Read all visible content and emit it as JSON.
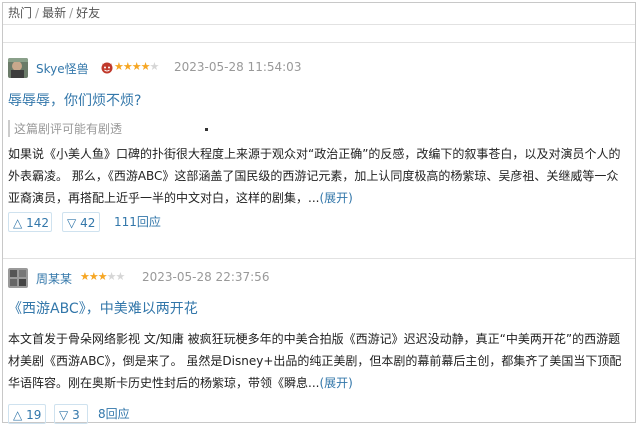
{
  "tabs": {
    "hot": "热门",
    "latest": "最新",
    "friends": "好友",
    "sep": "/"
  },
  "reviews": [
    {
      "user": "Skye怪兽",
      "user_icon": "devil-face-icon",
      "rating": 4,
      "time": "2023-05-28 11:54:03",
      "title": "辱辱辱，你们烦不烦?",
      "spoiler": "这篇剧评可能有剧透",
      "body": "如果说《小美人鱼》口碑的扑街很大程度上来源于观众对“政治正确”的反感，改编下的叙事苍白，以及对演员个人的外表霸凌。 那么，《西游ABC》这部涵盖了国民级的西游记元素，加上认同度极高的杨紫琼、吴彦祖、关继威等一众亚裔演员，再搭配上近乎一半的中文对白，这样的剧集，...",
      "expand": "(展开)",
      "up": "142",
      "down": "42",
      "replies": "111回应"
    },
    {
      "user": "周某某",
      "rating": 3,
      "time": "2023-05-28 22:37:56",
      "title": "《西游ABC》，中美难以两开花",
      "body": "本文首发于骨朵网络影视 文/知庸 被疯狂玩梗多年的中美合拍版《西游记》迟迟没动静，真正“中美两开花”的西游题材美剧《西游ABC》，倒是来了。 虽然是Disney+出品的纯正美剧，但本剧的幕前幕后主创，都集齐了美国当下顶配华语阵容。刚在奥斯卡历史性封后的杨紫琼，带领《瞬息...",
      "expand": "(展开)",
      "up": "19",
      "down": "3",
      "replies": "8回应"
    }
  ],
  "colors": {
    "link": "#3377aa",
    "star": "#f6a623",
    "meta": "#999999"
  },
  "icons": {
    "up": "triangle-up-icon",
    "down": "triangle-down-icon",
    "star": "star-icon"
  }
}
